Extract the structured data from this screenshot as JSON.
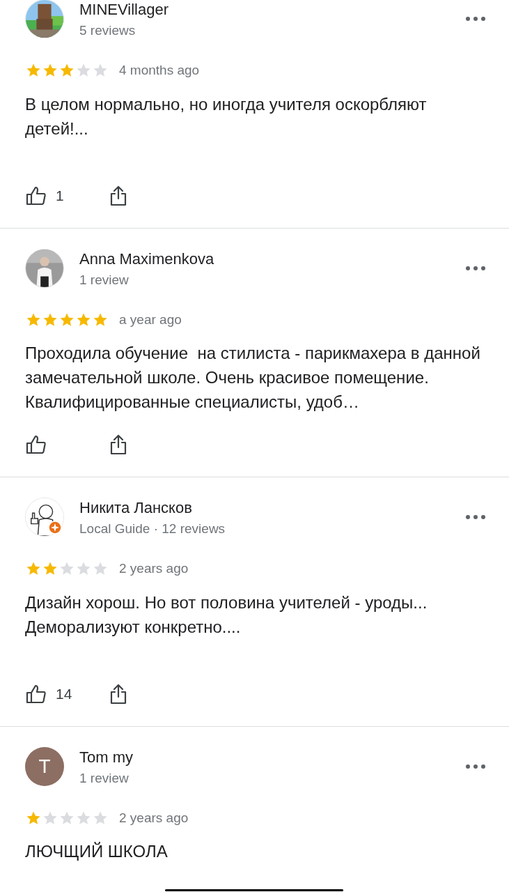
{
  "reviews": [
    {
      "name": "MINEVillager",
      "subtitle": "5 reviews",
      "avatar": {
        "kind": "picture"
      },
      "stars": 3,
      "time": "4 months ago",
      "text": "В целом нормально, но иногда учителя оскорбляют детей!...",
      "show_actions": true,
      "likes": "1"
    },
    {
      "name": "Anna Maximenkova",
      "subtitle": "1 review",
      "avatar": {
        "kind": "picture"
      },
      "stars": 5,
      "time": "a year ago",
      "text": "Проходила обучение  на стилиста - парикмахера в данной замечательной школе. Очень красивое помещение. Квалифицированные специалисты, удоб…",
      "show_actions": true
    },
    {
      "name": "Никита Лансков",
      "subtitle": "Local Guide · 12 reviews",
      "avatar": {
        "kind": "picture",
        "local_guide": true
      },
      "stars": 2,
      "time": "2 years ago",
      "text": "Дизайн хорош. Но вот половина учителей - уроды... Деморализуют конкретно....",
      "show_actions": true,
      "likes": "14"
    },
    {
      "name": "Tom my",
      "subtitle": "1 review",
      "avatar": {
        "kind": "letter",
        "letter": "T",
        "color": "#8d6e63"
      },
      "stars": 1,
      "time": "2 years ago",
      "text": "ЛЮЧЩИЙ ШКОЛА",
      "show_actions": false
    }
  ]
}
